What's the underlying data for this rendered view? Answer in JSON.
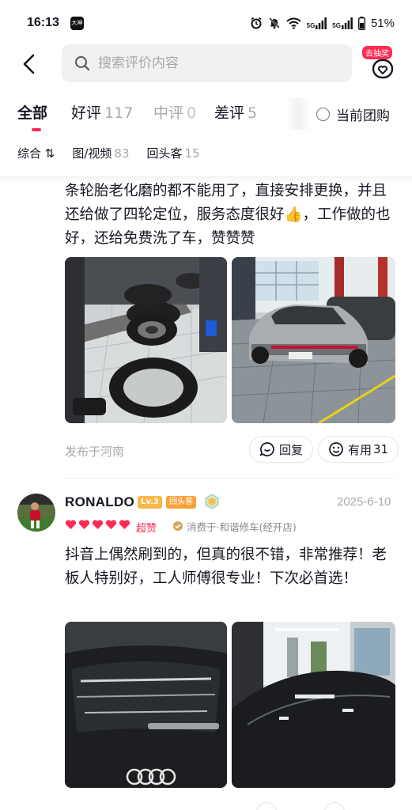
{
  "status_bar": {
    "time": "16:13",
    "app_badge": "大神",
    "battery": "51%",
    "network1": "5G",
    "network2": "5G",
    "icons": [
      "alarm-icon",
      "mute-icon",
      "wifi-icon",
      "signal-icon",
      "signal-icon",
      "battery-icon"
    ]
  },
  "header": {
    "search_placeholder": "搜索评价内容",
    "lottery_badge": "去抽奖"
  },
  "tabs": [
    {
      "label": "全部",
      "count": ""
    },
    {
      "label": "好评",
      "count": "117"
    },
    {
      "label": "中评",
      "count": "0"
    },
    {
      "label": "差评",
      "count": "5"
    }
  ],
  "group_buy_label": "当前团购",
  "subtabs": [
    {
      "label": "综合 ⇅",
      "count": ""
    },
    {
      "label": "图/视频",
      "count": "83"
    },
    {
      "label": "回头客",
      "count": "15"
    }
  ],
  "reviews": [
    {
      "text": "条轮胎老化磨的都不能用了，直接安排更换，并且还给做了四轮定位，服务态度很好👍，工作做的也好，还给免费洗了车，赞赞赞",
      "location": "发布于河南",
      "reply_label": "回复",
      "useful_label": "有用",
      "useful_count": "31"
    },
    {
      "username": "RONALDO",
      "level": "Lv.3",
      "returning_badge": "回头客",
      "date": "2025-6-10",
      "rating_hearts": 5,
      "rating_label": "超赞",
      "consumed_at": "消费于·和谐修车(经开店)",
      "text": "抖音上偶然刷到的，但真的很不错，非常推荐！老板人特别好，工人师傅很专业！下次必首选！"
    }
  ],
  "colors": {
    "accent": "#fe2c55",
    "muted": "#a8a8ad",
    "text": "#161823"
  }
}
